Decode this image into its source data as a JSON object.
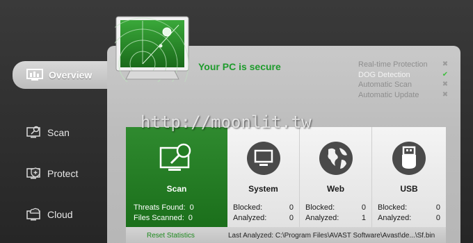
{
  "sidebar": {
    "items": [
      {
        "label": "Overview",
        "icon": "overview-icon"
      },
      {
        "label": "Scan",
        "icon": "scan-icon"
      },
      {
        "label": "Protect",
        "icon": "protect-icon"
      },
      {
        "label": "Cloud",
        "icon": "cloud-icon"
      }
    ]
  },
  "status": {
    "title": "Your PC is secure",
    "protections": [
      {
        "label": "Real-time Protection",
        "state": "off"
      },
      {
        "label": "DOG Detection",
        "state": "on"
      },
      {
        "label": "Automatic Scan",
        "state": "off"
      },
      {
        "label": "Automatic Update",
        "state": "off"
      }
    ]
  },
  "watermark": "http://moonlit.tw",
  "tiles": {
    "scan": {
      "title": "Scan",
      "threats_label": "Threats Found:",
      "threats_value": "0",
      "files_label": "Files Scanned:",
      "files_value": "0"
    },
    "system": {
      "title": "System",
      "blocked_label": "Blocked:",
      "blocked_value": "0",
      "analyzed_label": "Analyzed:",
      "analyzed_value": "0"
    },
    "web": {
      "title": "Web",
      "blocked_label": "Blocked:",
      "blocked_value": "0",
      "analyzed_label": "Analyzed:",
      "analyzed_value": "1"
    },
    "usb": {
      "title": "USB",
      "blocked_label": "Blocked:",
      "blocked_value": "0",
      "analyzed_label": "Analyzed:",
      "analyzed_value": "0"
    }
  },
  "footer": {
    "reset_label": "Reset Statistics",
    "last_analyzed": "Last Analyzed:  C:\\Program Files\\AVAST Software\\Avast\\de...\\Sf.bin"
  },
  "colors": {
    "accent_green": "#1e9b2c",
    "tile_green": "#2f8a2f",
    "ok_mark": "#3fbf3f"
  }
}
